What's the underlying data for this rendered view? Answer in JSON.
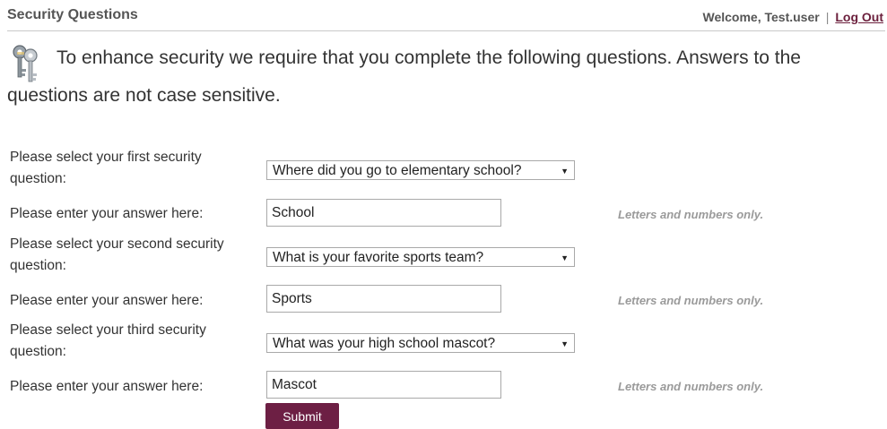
{
  "header": {
    "title": "Security Questions",
    "welcome": "Welcome, Test.user",
    "separator": "|",
    "logout": "Log Out"
  },
  "intro": {
    "icon": "keys-icon",
    "text": "To enhance security we require that you complete the following questions. Answers to the questions are not case sensitive."
  },
  "form": {
    "questions": [
      {
        "select_label": "Please select your first security question:",
        "selected": "Where did you go to elementary school?",
        "answer_label": "Please enter your answer here:",
        "answer_value": "School",
        "hint": "Letters and numbers only."
      },
      {
        "select_label": "Please select your second security question:",
        "selected": "What is your favorite sports team?",
        "answer_label": "Please enter your answer here:",
        "answer_value": "Sports",
        "hint": "Letters and numbers only."
      },
      {
        "select_label": "Please select your third security question:",
        "selected": "What was your high school mascot?",
        "answer_label": "Please enter your answer here:",
        "answer_value": "Mascot",
        "hint": "Letters and numbers only."
      }
    ],
    "submit_label": "Submit"
  },
  "colors": {
    "accent": "#6d1f44",
    "hint": "#9a9a9a"
  }
}
